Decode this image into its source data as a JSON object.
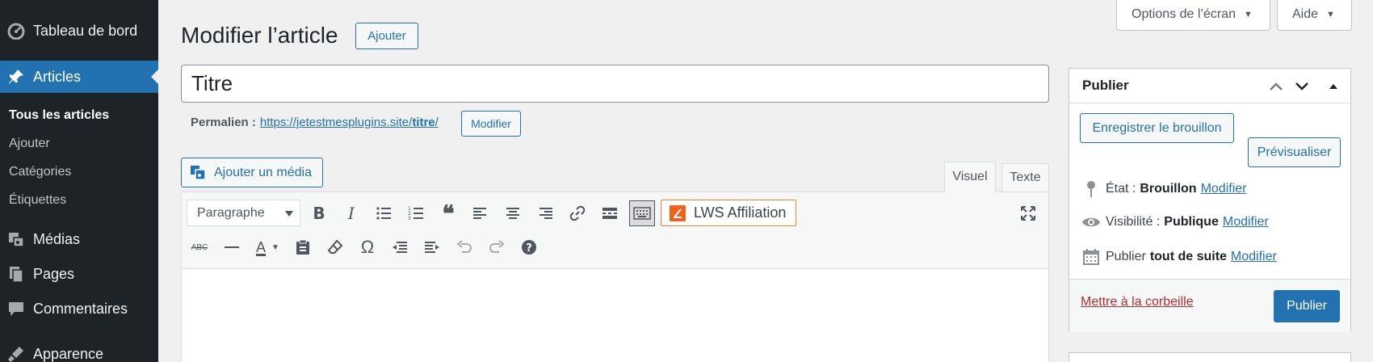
{
  "sidebar": {
    "items": [
      {
        "label": "Tableau de bord",
        "icon": "dashboard-icon"
      },
      {
        "label": "Articles",
        "icon": "pin-icon"
      },
      {
        "label": "Médias",
        "icon": "media-icon"
      },
      {
        "label": "Pages",
        "icon": "pages-icon"
      },
      {
        "label": "Commentaires",
        "icon": "comments-icon"
      },
      {
        "label": "Apparence",
        "icon": "appearance-icon"
      }
    ],
    "submenu": [
      "Tous les articles",
      "Ajouter",
      "Catégories",
      "Étiquettes"
    ]
  },
  "topbar": {
    "screen_options": "Options de l’écran",
    "help": "Aide"
  },
  "header": {
    "title": "Modifier l’article",
    "add_button": "Ajouter"
  },
  "post": {
    "title_value": "Titre",
    "permalink_label": "Permalien :",
    "permalink_url": "https://jetestmesplugins.site/titre/",
    "permalink_base": "https://jetestmesplugins.site/",
    "permalink_slug": "titre",
    "permalink_edit": "Modifier"
  },
  "editor": {
    "add_media": "Ajouter un média",
    "tab_visual": "Visuel",
    "tab_text": "Texte",
    "format_select": "Paragraphe",
    "lws_button": "LWS Affiliation"
  },
  "publish": {
    "title": "Publier",
    "save_draft": "Enregistrer le brouillon",
    "preview": "Prévisualiser",
    "status_label": "État :",
    "status_value": "Brouillon",
    "visibility_label": "Visibilité :",
    "visibility_value": "Publique",
    "schedule_label": "Publier",
    "schedule_value": "tout de suite",
    "edit_link": "Modifier",
    "trash": "Mettre à la corbeille",
    "publish_button": "Publier"
  },
  "colors": {
    "accent": "#2271b1",
    "sidebar_bg": "#1d2327",
    "trash": "#b32d2e",
    "lws": "#f0621d"
  }
}
